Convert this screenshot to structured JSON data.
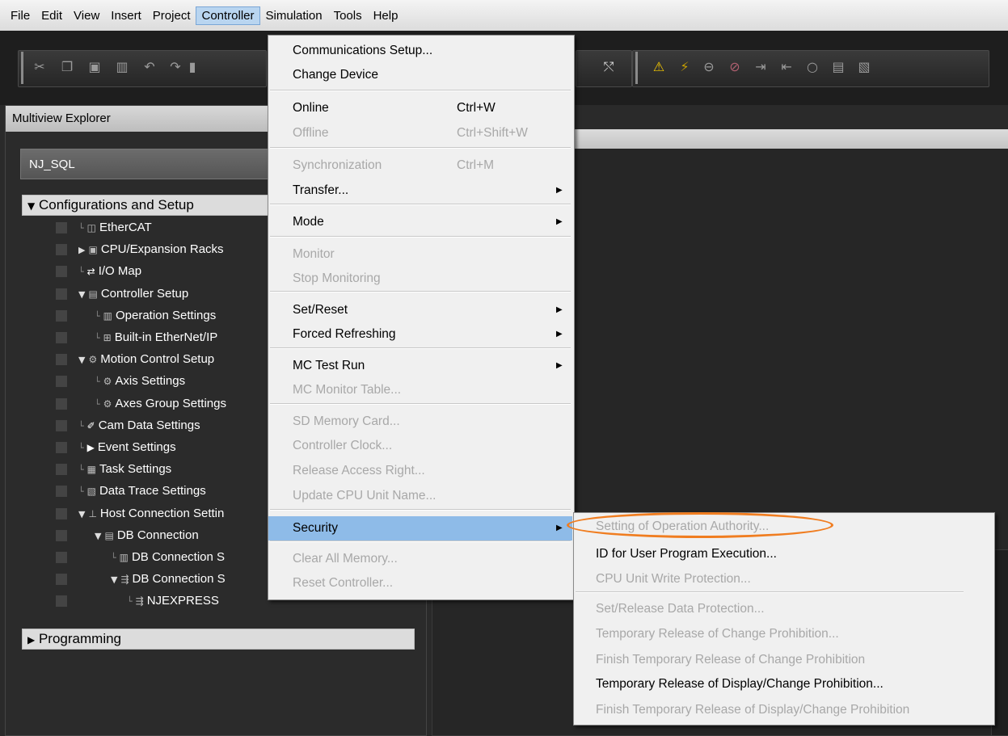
{
  "menubar": {
    "items": [
      "File",
      "Edit",
      "View",
      "Insert",
      "Project",
      "Controller",
      "Simulation",
      "Tools",
      "Help"
    ],
    "active": "Controller"
  },
  "toolbar": {
    "icons": [
      "cut-icon",
      "copy-icon",
      "paste-icon",
      "delete-icon",
      "undo-icon",
      "redo-icon",
      "paste-special-icon",
      "controller-setup-icon",
      "warning-icon",
      "online-icon",
      "watch-icon",
      "watch-off-icon",
      "transfer-to-icon",
      "transfer-from-icon",
      "compare-icon",
      "build-icon",
      "rebuild-icon"
    ],
    "accent": "#f5c800"
  },
  "explorer": {
    "title": "Multiview Explorer",
    "device": "NJ_SQL",
    "config_section": "Configurations and Setup",
    "programming_section": "Programming",
    "tree": [
      {
        "label": "EtherCAT",
        "marker": "└",
        "icon": "◫"
      },
      {
        "label": "CPU/Expansion Racks",
        "marker": "▶",
        "icon": "▣"
      },
      {
        "label": "I/O Map",
        "marker": "└",
        "icon": "⇄"
      },
      {
        "label": "Controller Setup",
        "marker": "▼",
        "icon": "▤"
      },
      {
        "label": "Operation Settings",
        "marker": "└",
        "icon": "▥"
      },
      {
        "label": "Built-in EtherNet/IP",
        "marker": "└",
        "icon": "⊞"
      },
      {
        "label": "Motion Control Setup",
        "marker": "▼",
        "icon": "⚙"
      },
      {
        "label": "Axis Settings",
        "marker": "└",
        "icon": "⚙"
      },
      {
        "label": "Axes Group Settings",
        "marker": "└",
        "icon": "⚙"
      },
      {
        "label": "Cam Data Settings",
        "marker": "└",
        "icon": "✐"
      },
      {
        "label": "Event Settings",
        "marker": "└",
        "icon": "▶"
      },
      {
        "label": "Task Settings",
        "marker": "└",
        "icon": "▦"
      },
      {
        "label": "Data Trace Settings",
        "marker": "└",
        "icon": "▧"
      },
      {
        "label": "Host Connection Settin",
        "marker": "▼",
        "icon": "⊥"
      },
      {
        "label": "DB Connection",
        "marker": "▼",
        "icon": "▤"
      },
      {
        "label": "DB Connection S",
        "marker": "└",
        "icon": "▥"
      },
      {
        "label": "DB Connection S",
        "marker": "▼",
        "icon": "⇶"
      },
      {
        "label": "NJEXPRESS",
        "marker": "└",
        "icon": "⇶"
      }
    ]
  },
  "controller_menu": [
    {
      "label": "Communications Setup...",
      "shortcut": "",
      "submenu": false,
      "disabled": false
    },
    {
      "label": "Change Device",
      "shortcut": "",
      "submenu": false,
      "disabled": false
    },
    {
      "label": "Online",
      "shortcut": "Ctrl+W",
      "submenu": false,
      "disabled": false
    },
    {
      "label": "Offline",
      "shortcut": "Ctrl+Shift+W",
      "submenu": false,
      "disabled": true
    },
    {
      "label": "Synchronization",
      "shortcut": "Ctrl+M",
      "submenu": false,
      "disabled": true
    },
    {
      "label": "Transfer...",
      "shortcut": "",
      "submenu": true,
      "disabled": false
    },
    {
      "label": "Mode",
      "shortcut": "",
      "submenu": true,
      "disabled": false
    },
    {
      "label": "Monitor",
      "shortcut": "",
      "submenu": false,
      "disabled": true
    },
    {
      "label": "Stop Monitoring",
      "shortcut": "",
      "submenu": false,
      "disabled": true
    },
    {
      "label": "Set/Reset",
      "shortcut": "",
      "submenu": true,
      "disabled": false
    },
    {
      "label": "Forced Refreshing",
      "shortcut": "",
      "submenu": true,
      "disabled": false
    },
    {
      "label": "MC Test Run",
      "shortcut": "",
      "submenu": true,
      "disabled": false
    },
    {
      "label": "MC Monitor Table...",
      "shortcut": "",
      "submenu": false,
      "disabled": true
    },
    {
      "label": "SD Memory Card...",
      "shortcut": "",
      "submenu": false,
      "disabled": true
    },
    {
      "label": "Controller Clock...",
      "shortcut": "",
      "submenu": false,
      "disabled": true
    },
    {
      "label": "Release Access Right...",
      "shortcut": "",
      "submenu": false,
      "disabled": true
    },
    {
      "label": "Update CPU Unit Name...",
      "shortcut": "",
      "submenu": false,
      "disabled": true
    },
    {
      "label": "Security",
      "shortcut": "",
      "submenu": true,
      "disabled": false,
      "highlighted": true
    },
    {
      "label": "Clear All Memory...",
      "shortcut": "",
      "submenu": false,
      "disabled": true
    },
    {
      "label": "Reset Controller...",
      "shortcut": "",
      "submenu": false,
      "disabled": true
    }
  ],
  "security_menu": [
    {
      "label": "Setting of Operation Authority...",
      "disabled": true,
      "circled": true
    },
    {
      "label": "ID for User Program Execution...",
      "disabled": false
    },
    {
      "label": "CPU Unit Write Protection...",
      "disabled": true
    },
    {
      "label": "Set/Release Data Protection...",
      "disabled": true
    },
    {
      "label": "Temporary Release of Change Prohibition...",
      "disabled": true
    },
    {
      "label": "Finish Temporary Release of Change Prohibition",
      "disabled": true
    },
    {
      "label": "Temporary Release of Display/Change Prohibition...",
      "disabled": false
    },
    {
      "label": "Finish Temporary Release of Display/Change Prohibition",
      "disabled": true
    }
  ],
  "colors": {
    "highlight": "#8ebbe8",
    "disabled_text": "#a8a8a8",
    "annotation_oval": "#f07d20"
  }
}
